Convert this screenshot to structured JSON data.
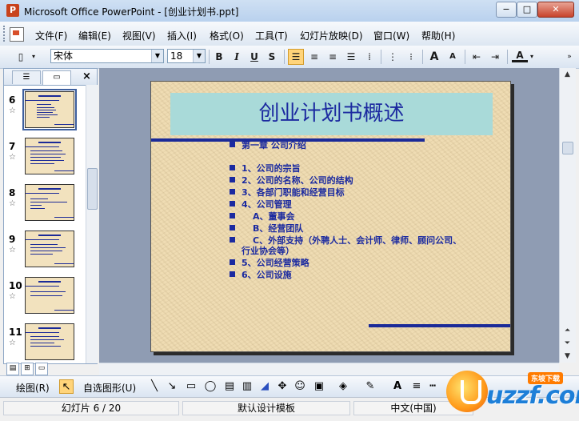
{
  "window": {
    "title": "Microsoft Office PowerPoint - [创业计划书.ppt]",
    "app_icon_letter": "P",
    "min": "−",
    "max": "□",
    "close": "✕"
  },
  "menu": [
    "文件(F)",
    "编辑(E)",
    "视图(V)",
    "插入(I)",
    "格式(O)",
    "工具(T)",
    "幻灯片放映(D)",
    "窗口(W)",
    "帮助(H)"
  ],
  "formatting": {
    "font_name": "宋体",
    "font_size": "18",
    "bold": "B",
    "italic": "I",
    "underline": "U",
    "shadow": "S",
    "grow": "A",
    "shrink": "A",
    "font_color": "A"
  },
  "panel": {
    "tab_outline": "☰",
    "tab_slides": "▭",
    "close": "×",
    "slides": [
      {
        "num": "6",
        "star": "☆",
        "selected": true
      },
      {
        "num": "7",
        "star": "☆",
        "selected": false
      },
      {
        "num": "8",
        "star": "☆",
        "selected": false
      },
      {
        "num": "9",
        "star": "☆",
        "selected": false
      },
      {
        "num": "10",
        "star": "☆",
        "selected": false
      },
      {
        "num": "11",
        "star": "☆",
        "selected": false
      }
    ]
  },
  "slide": {
    "title": "创业计划书概述",
    "bullets": [
      "第一章 公司介绍",
      "1、公司的宗旨",
      "2、公司的名称、公司的结构",
      "3、各部门职能和经营目标",
      "4、公司管理",
      "A、董事会",
      "B、经营团队",
      "C、外部支持（外聘人士、会计师、律师、顾问公司、",
      "行业协会等）",
      "5、公司经营策略",
      "6、公司设施"
    ]
  },
  "drawing": {
    "draw_label": "绘图(R)",
    "autoshape_label": "自选图形(U)"
  },
  "status": {
    "slide_counter": "幻灯片 6 / 20",
    "design": "默认设计模板",
    "language": "中文(中国)"
  },
  "logo": {
    "text": "uzzf.com",
    "tag": "东坡下载"
  }
}
